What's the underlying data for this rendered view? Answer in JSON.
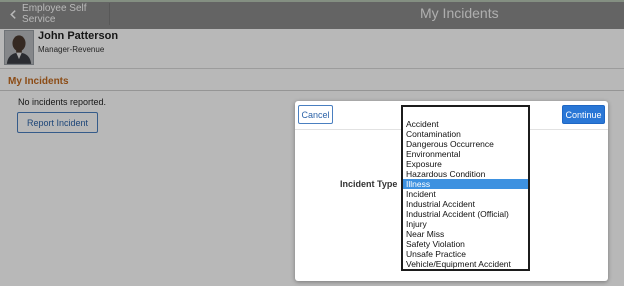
{
  "header": {
    "back_label": "Employee Self Service",
    "title": "My Incidents"
  },
  "profile": {
    "name": "John Patterson",
    "role": "Manager-Revenue"
  },
  "section": {
    "title": "My Incidents",
    "empty_message": "No incidents reported.",
    "report_button": "Report Incident"
  },
  "modal": {
    "cancel_label": "Cancel",
    "continue_label": "Continue",
    "field_label": "Incident Type",
    "selected_option": "Illness",
    "options": [
      "Accident",
      "Contamination",
      "Dangerous Occurrence",
      "Environmental",
      "Exposure",
      "Hazardous Condition",
      "Illness",
      "Incident",
      "Industrial Accident",
      "Industrial Accident (Official)",
      "Injury",
      "Near Miss",
      "Safety Violation",
      "Unsafe Practice",
      "Vehicle/Equipment Accident"
    ]
  },
  "colors": {
    "header_bg": "#8b8b8b",
    "section_title": "#c26a1f",
    "primary_button": "#2a77d6",
    "selected_option_bg": "#3d91e0"
  },
  "icons": {
    "back": "chevron-left-icon",
    "avatar": "person-photo"
  }
}
